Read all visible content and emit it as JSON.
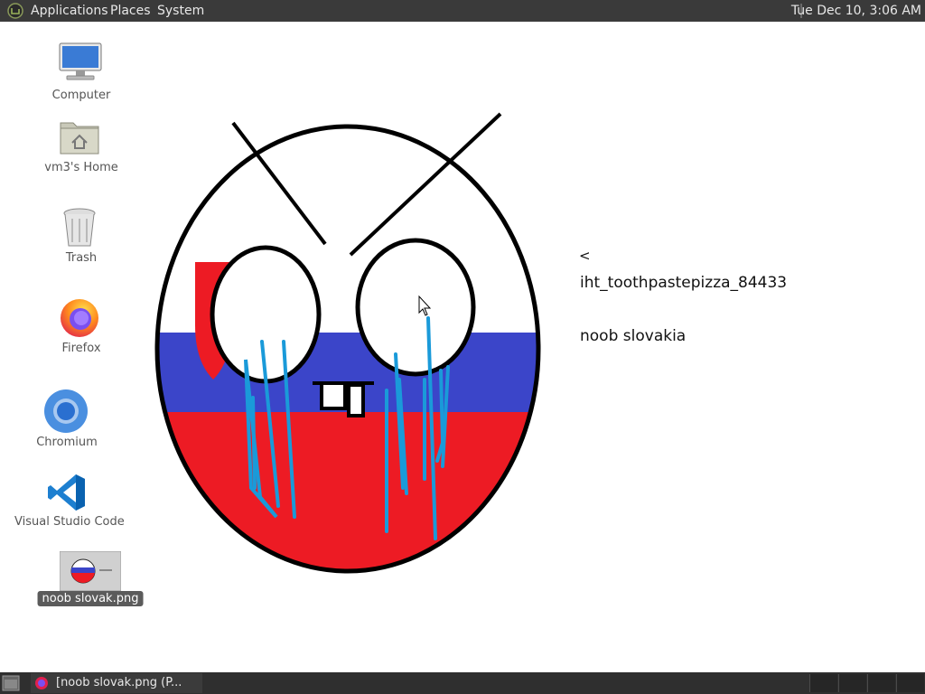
{
  "top_panel": {
    "menus": [
      "Applications",
      "Places",
      "System"
    ],
    "clock": "Tue Dec 10,  3:06 AM"
  },
  "desktop": {
    "icons": [
      {
        "name": "Computer",
        "icon": "monitor-icon"
      },
      {
        "name": "vm3's Home",
        "icon": "home-folder-icon"
      },
      {
        "name": "Trash",
        "icon": "trash-icon"
      },
      {
        "name": "Firefox",
        "icon": "firefox-icon"
      },
      {
        "name": "Chromium",
        "icon": "chromium-icon"
      },
      {
        "name": "Visual Studio Code",
        "icon": "vscode-icon"
      },
      {
        "name": "noob slovak.png",
        "icon": "image-thumbnail-icon"
      }
    ]
  },
  "image": {
    "arrow_text": "<",
    "username": "iht_toothpastepizza_84433",
    "caption": "noob slovakia"
  },
  "taskbar": {
    "window_title": "[noob slovak.png (P..."
  },
  "colors": {
    "panel": "#3a3a3a",
    "flag_white": "#ffffff",
    "flag_blue": "#3b45c9",
    "flag_red": "#ed1b24",
    "tears": "#1a9ad9"
  }
}
